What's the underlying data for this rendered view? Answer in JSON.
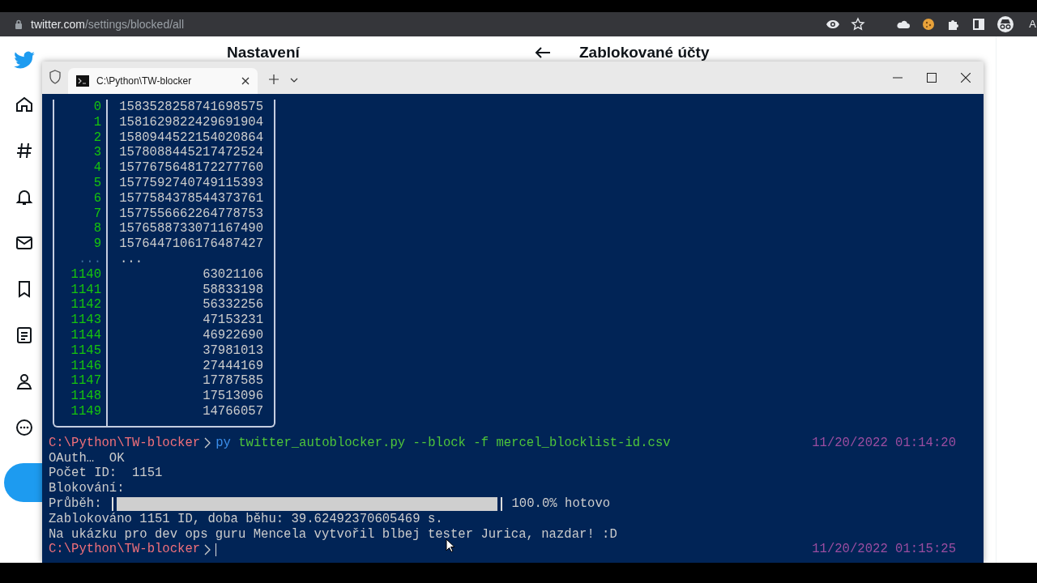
{
  "browser": {
    "url_host": "twitter.com",
    "url_path": "/settings/blocked/all",
    "profile_label": "A"
  },
  "twitter": {
    "settings_title": "Nastavení",
    "page_title": "Zablokované účty"
  },
  "terminal": {
    "tab_title": "C:\\Python\\TW-blocker",
    "table_rows": [
      {
        "kind": "row",
        "index": "0",
        "value": "1583528258741698575"
      },
      {
        "kind": "row",
        "index": "1",
        "value": "1581629822429691904"
      },
      {
        "kind": "row",
        "index": "2",
        "value": "1580944522154020864"
      },
      {
        "kind": "row",
        "index": "3",
        "value": "1578088445217472524"
      },
      {
        "kind": "row",
        "index": "4",
        "value": "1577675648172277760"
      },
      {
        "kind": "row",
        "index": "5",
        "value": "1577592740749115393"
      },
      {
        "kind": "row",
        "index": "6",
        "value": "1577584378544373761"
      },
      {
        "kind": "row",
        "index": "7",
        "value": "1577556662264778753"
      },
      {
        "kind": "row",
        "index": "8",
        "value": "1576588733071167490"
      },
      {
        "kind": "row",
        "index": "9",
        "value": "1576447106176487427"
      },
      {
        "kind": "gap",
        "index": "...",
        "value": "..."
      },
      {
        "kind": "row",
        "index": "1140",
        "value": "63021106"
      },
      {
        "kind": "row",
        "index": "1141",
        "value": "58833198"
      },
      {
        "kind": "row",
        "index": "1142",
        "value": "56332256"
      },
      {
        "kind": "row",
        "index": "1143",
        "value": "47153231"
      },
      {
        "kind": "row",
        "index": "1144",
        "value": "46922690"
      },
      {
        "kind": "row",
        "index": "1145",
        "value": "37981013"
      },
      {
        "kind": "row",
        "index": "1146",
        "value": "27444169"
      },
      {
        "kind": "row",
        "index": "1147",
        "value": "17787585"
      },
      {
        "kind": "row",
        "index": "1148",
        "value": "17513096"
      },
      {
        "kind": "row",
        "index": "1149",
        "value": "14766057"
      }
    ],
    "lines": [
      {
        "kind": "command",
        "prompt": "C:\\Python\\TW-blocker",
        "program": "py",
        "args": "twitter_autoblocker.py --block -f mercel_blocklist-id.csv",
        "time": "11/20/2022 01:14:20"
      },
      {
        "kind": "text",
        "text": "OAuth…  OK"
      },
      {
        "kind": "text",
        "text": "Počet ID:  1151"
      },
      {
        "kind": "text",
        "text": "Blokování:"
      },
      {
        "kind": "progress",
        "label": "Průběh:",
        "level": 1,
        "reading": "100.0% hotovo"
      },
      {
        "kind": "text",
        "text": "Zablokováno 1151 ID, doba běhu: 39.62492370605469 s."
      },
      {
        "kind": "text",
        "text": "Na ukázku pro dev ops guru Mencela vytvořil blbej tester Jurica, nazdar! :D"
      },
      {
        "kind": "prompt",
        "prompt": "C:\\Python\\TW-blocker",
        "time": "11/20/2022 01:15:25"
      }
    ]
  }
}
